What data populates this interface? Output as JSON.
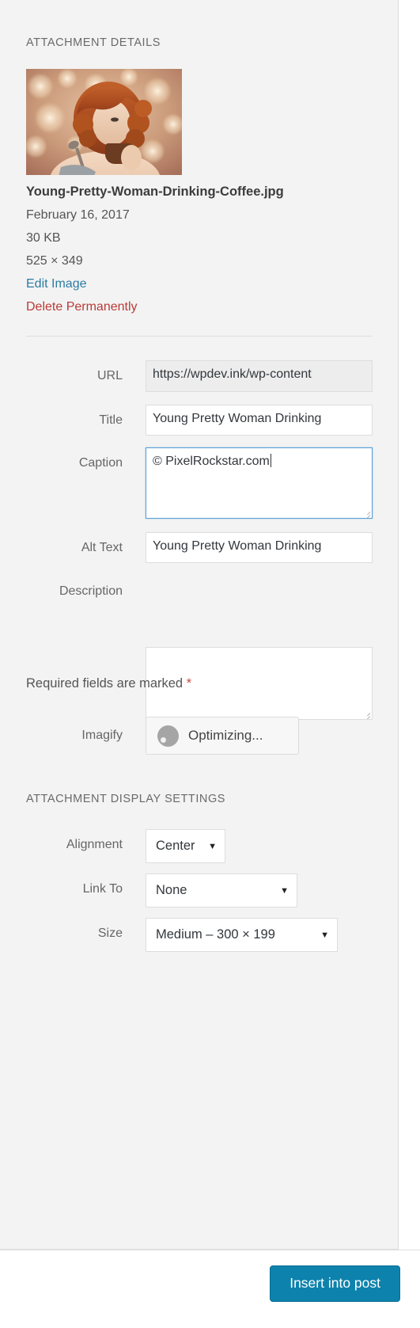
{
  "panel": {
    "attachment_details_title": "ATTACHMENT DETAILS",
    "display_settings_title": "ATTACHMENT DISPLAY SETTINGS"
  },
  "attachment": {
    "thumbnail_alt": "Young pretty woman drinking coffee",
    "file_name": "Young-Pretty-Woman-Drinking-Coffee.jpg",
    "date": "February 16, 2017",
    "size": "30 KB",
    "dimensions": "525 × 349",
    "edit_image_label": "Edit Image",
    "delete_label": "Delete Permanently"
  },
  "fields": {
    "url": {
      "label": "URL",
      "value": "https://wpdev.ink/wp-content"
    },
    "title": {
      "label": "Title",
      "value": "Young Pretty Woman Drinking"
    },
    "caption": {
      "label": "Caption",
      "value": "© PixelRockstar.com"
    },
    "alt_text": {
      "label": "Alt Text",
      "value": "Young Pretty Woman Drinking"
    },
    "description": {
      "label": "Description",
      "value": ""
    }
  },
  "required_note": {
    "text": "Required fields are marked ",
    "star": "*"
  },
  "imagify": {
    "label": "Imagify",
    "button_label": "Optimizing...",
    "spinner_icon": "loading-spinner-icon"
  },
  "display_settings": {
    "alignment": {
      "label": "Alignment",
      "value": "Center",
      "arrow": "▼"
    },
    "link_to": {
      "label": "Link To",
      "value": "None",
      "arrow": "▼"
    },
    "size": {
      "label": "Size",
      "value": "Medium – 300 × 199",
      "arrow": "▼"
    }
  },
  "footer": {
    "insert_label": "Insert into post"
  },
  "colors": {
    "panel_bg": "#f3f3f3",
    "link_blue": "#2b7ca3",
    "delete_red": "#b93a37",
    "focus_border": "#5b9dd9",
    "primary_button": "#0d82ad",
    "required_star": "#c9484a"
  }
}
